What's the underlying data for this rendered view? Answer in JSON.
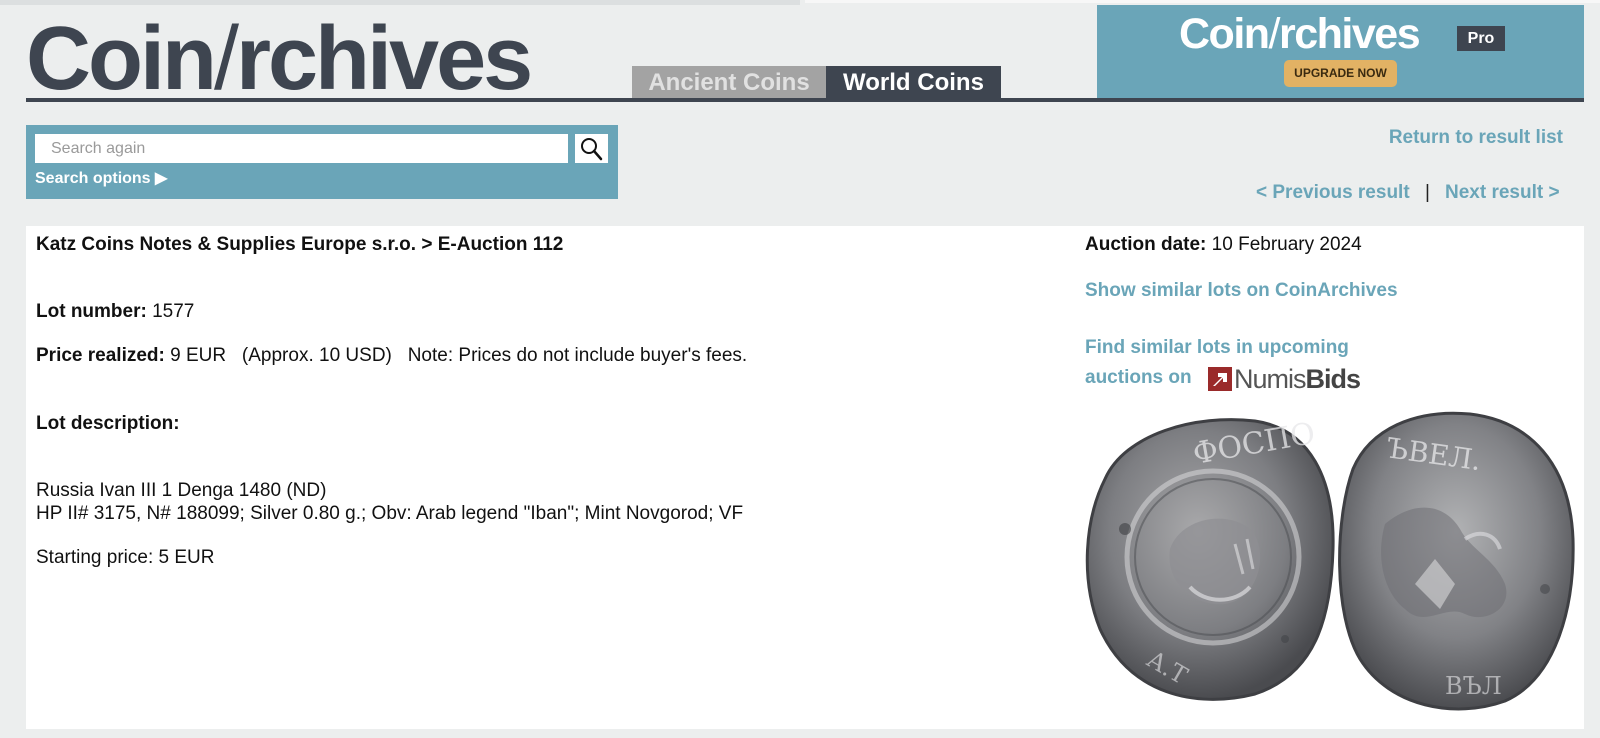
{
  "header": {
    "logo_part1": "Coin",
    "logo_slash": "/",
    "logo_part2": "rchives",
    "tabs": [
      {
        "label": "Ancient Coins"
      },
      {
        "label": "World Coins"
      }
    ],
    "pro": {
      "logo_part1": "Coin",
      "logo_slash": "/",
      "logo_part2": "rchives",
      "badge": "Pro",
      "upgrade_label": "UPGRADE NOW"
    }
  },
  "search": {
    "placeholder": "Search again",
    "options_label": "Search options ▶",
    "button_icon": "search-icon"
  },
  "nav": {
    "return_label": "Return to result list",
    "prev_label": "< Previous result",
    "separator": "|",
    "next_label": "Next result >"
  },
  "lot": {
    "breadcrumb": "Katz Coins Notes & Supplies Europe s.r.o. > E-Auction 112",
    "lot_number_label": "Lot number:",
    "lot_number": "1577",
    "price_label": "Price realized:",
    "price_value": "9 EUR   (Approx. 10 USD)   Note: Prices do not include buyer's fees.",
    "description_label": "Lot description:",
    "description_line1": "Russia Ivan III 1 Denga 1480 (ND)",
    "description_line2": "HP II# 3175, N# 188099; Silver 0.80 g.; Obv: Arab legend \"Iban\"; Mint Novgorod; VF",
    "starting_price": "Starting price: 5 EUR"
  },
  "sidebar": {
    "auction_date_label": "Auction date:",
    "auction_date": "10 February 2024",
    "similar_link": "Show similar lots on CoinArchives",
    "upcoming_line1": "Find similar lots in upcoming",
    "upcoming_line2": "auctions on",
    "numisbids_part1": "Numis",
    "numisbids_part2": "Bids"
  },
  "colors": {
    "accent": "#6aa5b8",
    "dark": "#3e4550",
    "upgrade": "#e2b264"
  }
}
